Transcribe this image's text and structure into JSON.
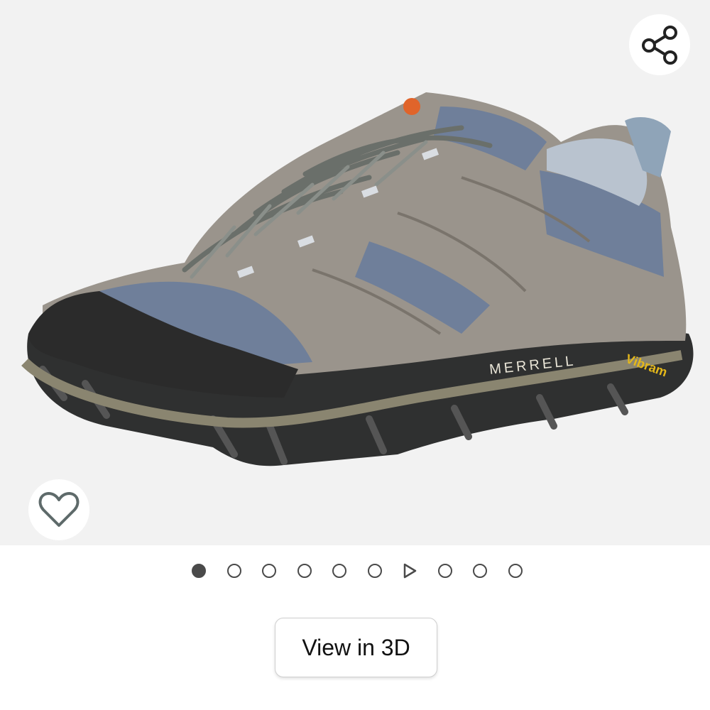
{
  "viewer": {
    "product_image_name": "hiking-shoe-photo",
    "brand_text": "MERRELL",
    "sole_text": "Vibram",
    "share_icon": "share-icon",
    "wishlist_icon": "heart-icon"
  },
  "carousel": {
    "total_items": 10,
    "active_index": 0,
    "video_index": 6
  },
  "actions": {
    "view_3d_label": "View in 3D"
  },
  "colors": {
    "background": "#f2f2f2",
    "dot": "#4a4a4a",
    "button_border": "#cfcfcf"
  }
}
